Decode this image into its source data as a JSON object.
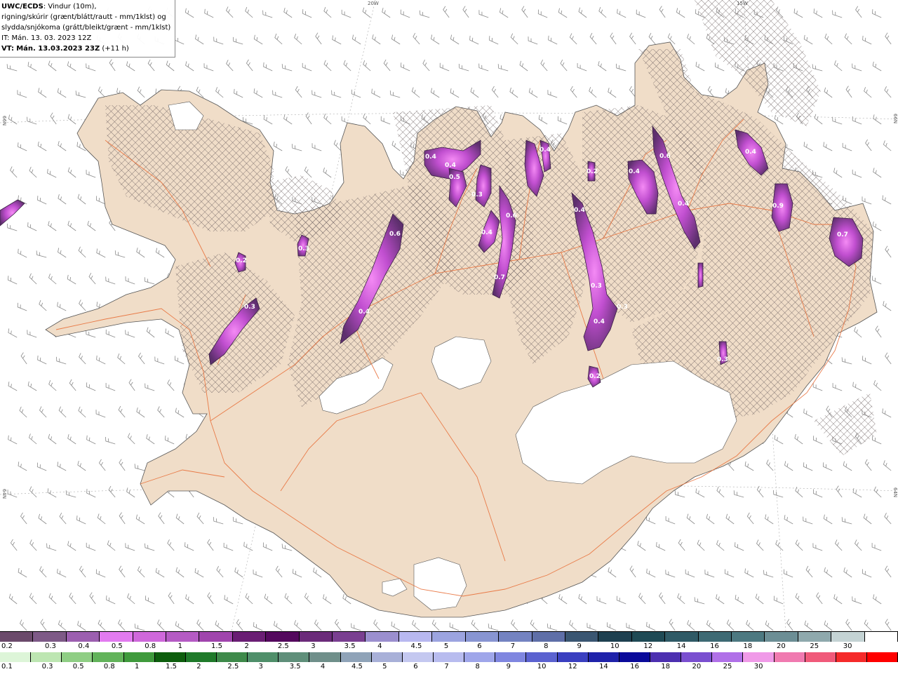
{
  "title": {
    "product": "UWC/ECDS",
    "line1_rest": ": Vindur (10m),",
    "line2": "rigning/skúrir (grænt/blátt/rautt - mm/1klst) og",
    "line3": "slydda/snjókoma (grátt/bleikt/grænt - mm/1klst)",
    "it_line": "IT: Mán. 13. 03. 2023 12Z",
    "vt_label": "VT:",
    "vt_bold": "Mán. 13.03.2023 23Z",
    "vt_rest": "(+11 h)"
  },
  "graticule_labels": {
    "lon_20w": "20W",
    "lon_15w": "15W",
    "lat_66n_left": "66N",
    "lat_66n_right": "66N",
    "lat_64n_left": "64N",
    "lat_64n_right": "64N"
  },
  "precip_labels": [
    {
      "text": "0.6",
      "area": "snaefellsnes-north"
    },
    {
      "text": "0.4",
      "area": "snaefellsnes-south"
    },
    {
      "text": "0.3",
      "area": "westfjords-south"
    },
    {
      "text": "0.2",
      "area": "westfjords-mid"
    },
    {
      "text": "0.3",
      "area": "hunafloi"
    },
    {
      "text": "0.4",
      "area": "skagi-west"
    },
    {
      "text": "0.4",
      "area": "skagi-east"
    },
    {
      "text": "0.5",
      "area": "skagafjordur"
    },
    {
      "text": "0.3",
      "area": "trollaskagi"
    },
    {
      "text": "0.6",
      "area": "eyjafjordur"
    },
    {
      "text": "0.7",
      "area": "eyjafjordur-south"
    },
    {
      "text": "0.4",
      "area": "akureyri"
    },
    {
      "text": "0.4",
      "area": "flateyjarskagi"
    },
    {
      "text": "0.2",
      "area": "skjalfandi"
    },
    {
      "text": "0.4",
      "area": "thingeyjarsysla"
    },
    {
      "text": "0.3",
      "area": "odadahraun-north"
    },
    {
      "text": "0.4",
      "area": "odadahraun"
    },
    {
      "text": "0.3",
      "area": "askja"
    },
    {
      "text": "0.6",
      "area": "melrakkasletta"
    },
    {
      "text": "0.4",
      "area": "axarfjordur"
    },
    {
      "text": "0.4",
      "area": "thistilfjordur"
    },
    {
      "text": "0.4",
      "area": "langanes"
    },
    {
      "text": "0.9",
      "area": "vopnafjordur"
    },
    {
      "text": "0.7",
      "area": "borgarfjordur-eystri"
    },
    {
      "text": "0.3",
      "area": "fljotsdalsheidi"
    },
    {
      "text": "0.2",
      "area": "vatnajokull-north"
    }
  ],
  "legend": {
    "snow_colors": [
      "#6b4a6b",
      "#7e5a87",
      "#9c5fb0",
      "#e27bf0",
      "#cf68db",
      "#b55bc4",
      "#a045ad",
      "#6a1e74",
      "#54095e",
      "#6b2b7a",
      "#7a3f91",
      "#9b8fcf",
      "#b8b8f0",
      "#9ca4e0",
      "#8895d2",
      "#7483c1",
      "#5f6fa8",
      "#3a5672",
      "#1e4050",
      "#1f4a55",
      "#2f5a66",
      "#3e6a74",
      "#4d7981",
      "#6c8e95",
      "#8fa9ad",
      "#c4d3d4",
      "#ffffff"
    ],
    "snow_labels": [
      "0.2",
      "0.3",
      "0.4",
      "0.5",
      "0.8",
      "1",
      "1.5",
      "2",
      "2.5",
      "3",
      "3.5",
      "4",
      "4.5",
      "5",
      "6",
      "7",
      "8",
      "9",
      "10",
      "12",
      "14",
      "16",
      "18",
      "20",
      "25",
      "30"
    ],
    "rain_colors": [
      "#ddf5d8",
      "#bde6b2",
      "#8fce84",
      "#62b35a",
      "#3f9a3c",
      "#0d5e0d",
      "#1f7a2a",
      "#3e8a4a",
      "#4f8f6a",
      "#5f8f7a",
      "#6f8f8a",
      "#8fa3b8",
      "#a8b0d8",
      "#c4c8f0",
      "#b8bcef",
      "#9fa6ea",
      "#7f86e0",
      "#5b62d0",
      "#3a3fc0",
      "#1f22aa",
      "#0a0a9a",
      "#4c2fb0",
      "#7a4fd0",
      "#b070e8",
      "#f09ae8",
      "#f07ab0",
      "#f05a7a",
      "#f52a2a",
      "#ff0000"
    ],
    "rain_labels": [
      "0.1",
      "0.3",
      "0.5",
      "0.8",
      "1",
      "1.5",
      "2",
      "2.5",
      "3",
      "3.5",
      "4",
      "4.5",
      "5",
      "6",
      "7",
      "8",
      "9",
      "10",
      "12",
      "14",
      "16",
      "18",
      "20",
      "25",
      "30"
    ]
  },
  "colors": {
    "land": "#f0ddc8",
    "roads": "#e8703a",
    "glacier": "#ffffff",
    "hatch": "#7a6a6a",
    "snow_dark": "#6b3a7a",
    "snow_light": "#e66ce8"
  }
}
